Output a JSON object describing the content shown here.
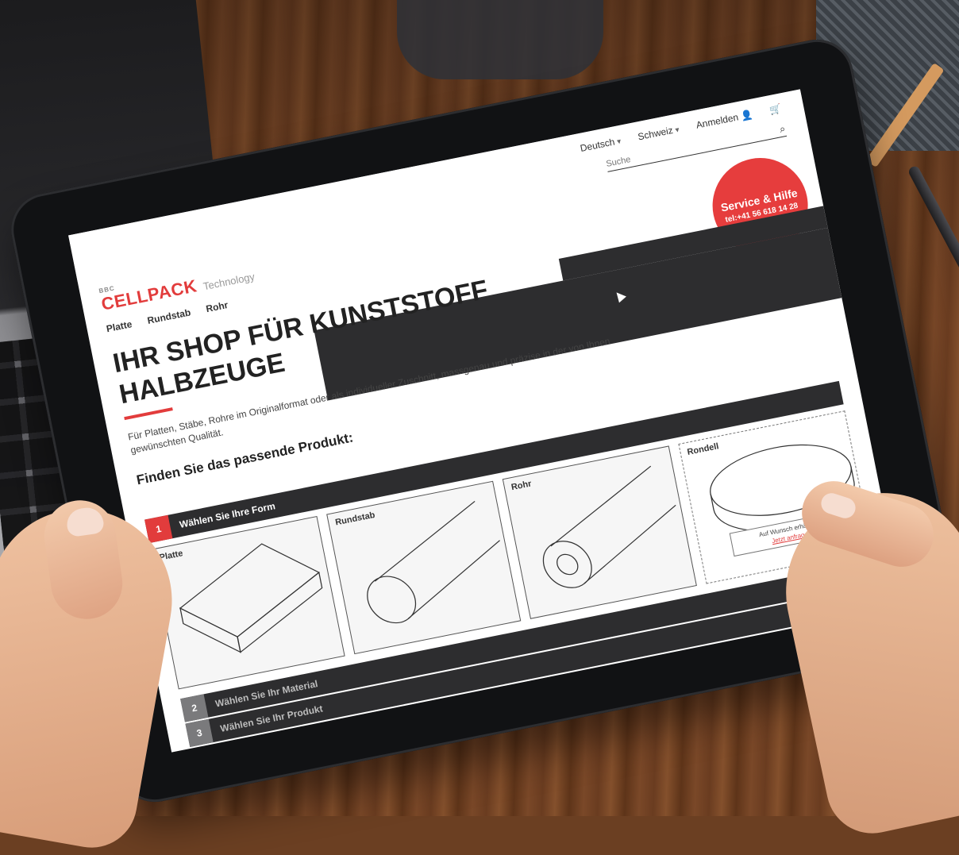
{
  "header": {
    "language": "Deutsch",
    "country": "Schweiz",
    "login": "Anmelden",
    "search_placeholder": "Suche"
  },
  "logo": {
    "small": "BBC",
    "name": "CELLPACK",
    "tagline": "Technology"
  },
  "nav": [
    "Platte",
    "Rundstab",
    "Rohr"
  ],
  "service": {
    "title": "Service & Hilfe",
    "phone": "tel:+41 56 618 14 28"
  },
  "hero": {
    "headline": "IHR SHOP FÜR KUNSTSTOFF HALBZEUGE",
    "intro": "Für Platten, Stäbe, Rohre im Originalformat oder als individueller Zuschnitt, massgenau und präzise in der von Ihnen gewünschten Qualität.",
    "finder_title": "Finden Sie das passende Produkt:"
  },
  "steps": [
    {
      "num": "1",
      "label": "Wählen Sie Ihre Form"
    },
    {
      "num": "2",
      "label": "Wählen Sie Ihr Material"
    },
    {
      "num": "3",
      "label": "Wählen Sie Ihr Produkt"
    }
  ],
  "shapes": [
    {
      "name": "Platte"
    },
    {
      "name": "Rundstab"
    },
    {
      "name": "Rohr"
    },
    {
      "name": "Rondell",
      "note": "Auf Wunsch erhältlich:",
      "link": "Jetzt anfragen"
    }
  ],
  "icons": [
    "user-icon",
    "cart-icon",
    "search-icon",
    "chevron-down-icon",
    "cursor-icon"
  ]
}
